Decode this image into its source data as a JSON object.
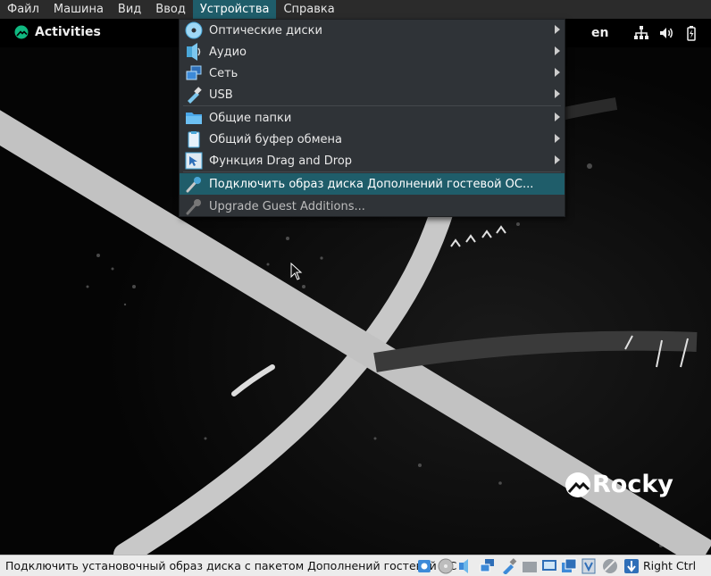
{
  "menubar": {
    "items": [
      {
        "label": "Файл"
      },
      {
        "label": "Машина"
      },
      {
        "label": "Вид"
      },
      {
        "label": "Ввод"
      },
      {
        "label": "Устройства"
      },
      {
        "label": "Справка"
      }
    ],
    "active_index": 4
  },
  "guest": {
    "activities_label": "Activities",
    "language": "en",
    "tray_icons": [
      "network-icon",
      "volume-icon",
      "battery-icon"
    ],
    "wallpaper_logo": "Rocky",
    "accent": "#10b981"
  },
  "devices_menu": {
    "items": [
      {
        "label": "Оптические диски",
        "icon": "optical-disc-icon",
        "submenu": true
      },
      {
        "label": "Аудио",
        "icon": "audio-icon",
        "submenu": true
      },
      {
        "label": "Сеть",
        "icon": "network-adapter-icon",
        "submenu": true
      },
      {
        "label": "USB",
        "icon": "usb-icon",
        "submenu": true
      },
      {
        "label": "Общие папки",
        "icon": "shared-folder-icon",
        "submenu": true
      },
      {
        "label": "Общий буфер обмена",
        "icon": "clipboard-icon",
        "submenu": true
      },
      {
        "label": "Функция Drag and Drop",
        "icon": "drag-drop-icon",
        "submenu": true
      },
      {
        "label": "Подключить образ диска Дополнений гостевой ОС...",
        "icon": "guest-additions-icon",
        "highlighted": true
      },
      {
        "label": "Upgrade Guest Additions...",
        "icon": "upgrade-guest-additions-icon",
        "disabled": true
      }
    ]
  },
  "statusbar": {
    "text": "Подключить установочный образ диска с пакетом Дополнений гостевой ОС",
    "icons": [
      "hard-disk-icon",
      "optical-drive-icon",
      "audio-status-icon",
      "network-status-icon",
      "usb-status-icon",
      "shared-folders-status-icon",
      "display-status-icon",
      "recording-status-icon",
      "vt-x-icon",
      "mouse-integration-icon",
      "keyboard-capture-icon"
    ],
    "host_key": "Right Ctrl"
  },
  "colors": {
    "menu_highlight": "#1f5d6a",
    "menubar_bg": "#2b2b2b",
    "menu_bg": "#2f3337",
    "statusbar_bg": "#ececec"
  }
}
